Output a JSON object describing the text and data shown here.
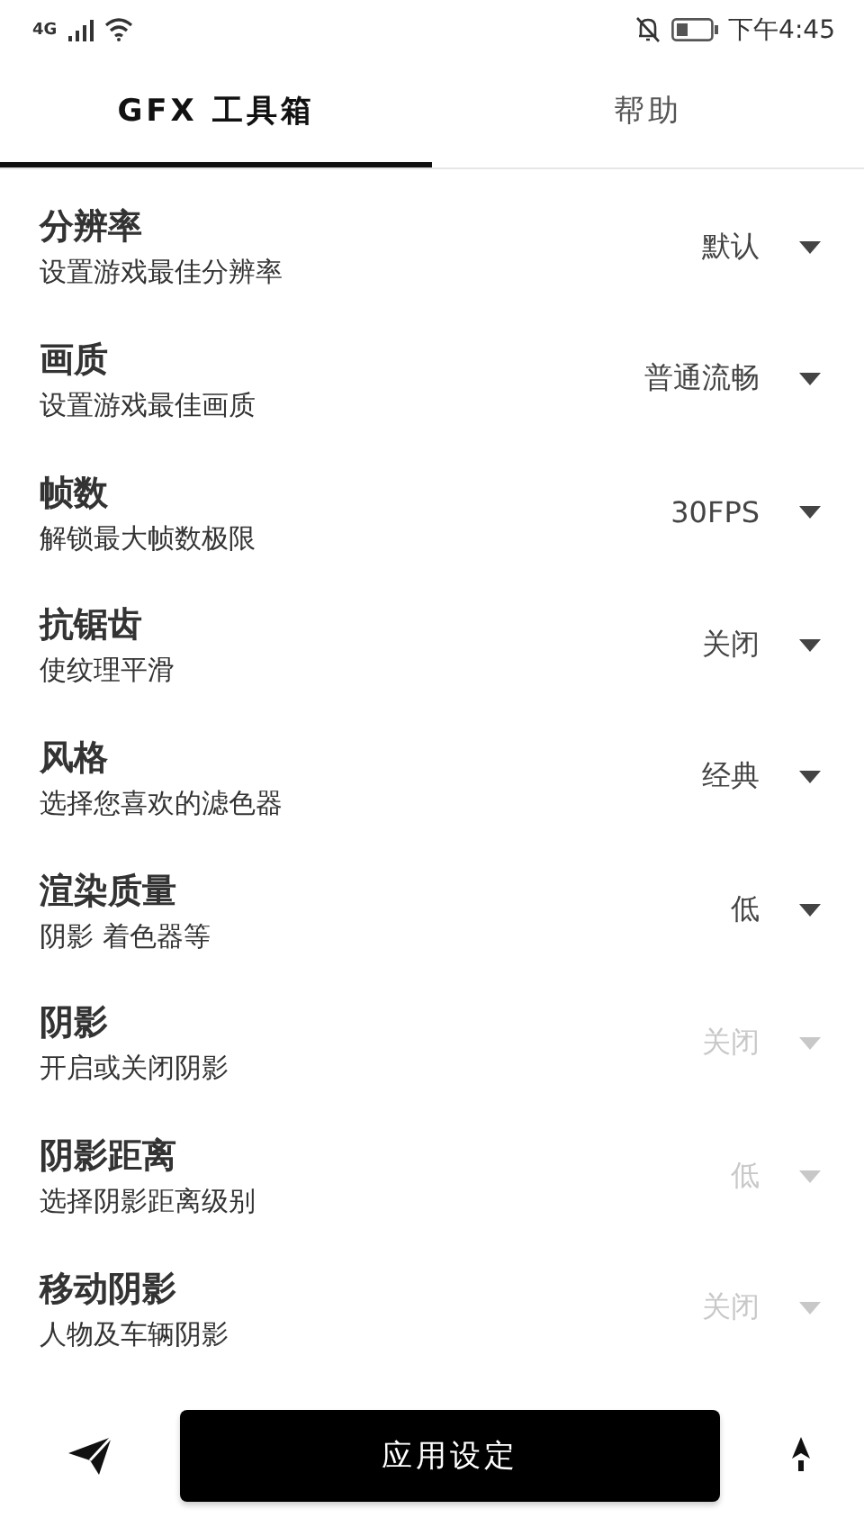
{
  "status_bar": {
    "network": "4G",
    "time": "下午4:45"
  },
  "tabs": [
    {
      "label": "GFX 工具箱",
      "selected": true
    },
    {
      "label": "帮助",
      "selected": false
    }
  ],
  "settings": [
    {
      "title": "分辨率",
      "subtitle": "设置游戏最佳分辨率",
      "value": "默认",
      "disabled": false
    },
    {
      "title": "画质",
      "subtitle": "设置游戏最佳画质",
      "value": "普通流畅",
      "disabled": false
    },
    {
      "title": "帧数",
      "subtitle": "解锁最大帧数极限",
      "value": "30FPS",
      "disabled": false
    },
    {
      "title": "抗锯齿",
      "subtitle": "使纹理平滑",
      "value": "关闭",
      "disabled": false
    },
    {
      "title": "风格",
      "subtitle": "选择您喜欢的滤色器",
      "value": "经典",
      "disabled": false
    },
    {
      "title": "渲染质量",
      "subtitle": "阴影 着色器等",
      "value": "低",
      "disabled": false
    },
    {
      "title": "阴影",
      "subtitle": "开启或关闭阴影",
      "value": "关闭",
      "disabled": true
    },
    {
      "title": "阴影距离",
      "subtitle": "选择阴影距离级别",
      "value": "低",
      "disabled": true
    },
    {
      "title": "移动阴影",
      "subtitle": "人物及车辆阴影",
      "value": "关闭",
      "disabled": true
    }
  ],
  "apply_button": "应用设定"
}
